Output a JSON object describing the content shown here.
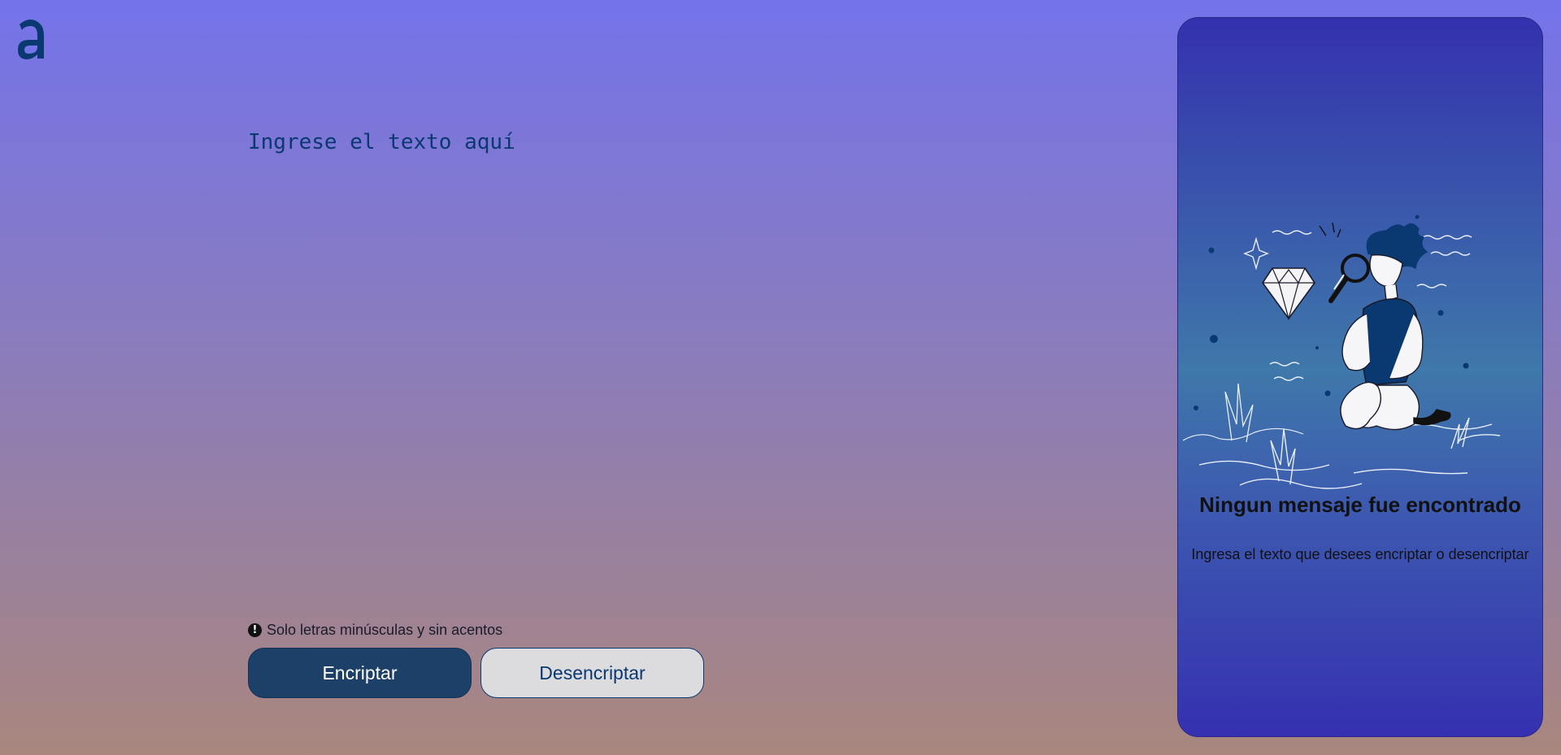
{
  "logo": {
    "glyph": "a",
    "color": "#0a3871"
  },
  "input": {
    "placeholder": "Ingrese el texto aquí",
    "value": ""
  },
  "hint": {
    "icon": "exclamation-icon",
    "text": "Solo letras minúsculas y sin acentos"
  },
  "buttons": {
    "encrypt_label": "Encriptar",
    "decrypt_label": "Desencriptar"
  },
  "panel": {
    "title": "Ningun mensaje fue encontrado",
    "subtitle": "Ingresa el texto que desees encriptar o desencriptar",
    "illustration": "person-with-magnifying-glass-and-diamond"
  },
  "colors": {
    "accent": "#0a3871",
    "encrypt_bg": "#1d4068",
    "decrypt_bg": "#dcdcdf",
    "panel_top": "#3431ae",
    "panel_mid": "#3f78aa"
  }
}
